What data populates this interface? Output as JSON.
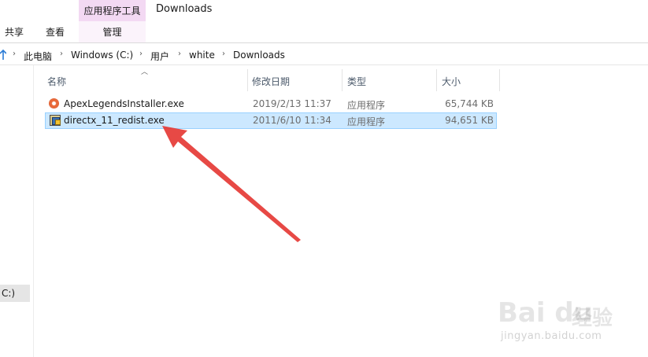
{
  "ribbon": {
    "tabs": [
      {
        "label": "共享"
      },
      {
        "label": "查看"
      }
    ],
    "contextual_group": "应用程序工具",
    "contextual_tab": "管理",
    "window_title": "Downloads"
  },
  "breadcrumb": [
    "此电脑",
    "Windows (C:)",
    "用户",
    "white",
    "Downloads"
  ],
  "columns": {
    "name": "名称",
    "date": "修改日期",
    "type": "类型",
    "size": "大小"
  },
  "files": [
    {
      "name": "ApexLegendsInstaller.exe",
      "date": "2019/2/13 11:37",
      "type": "应用程序",
      "size": "65,744 KB",
      "icon": "apex-icon",
      "selected": false
    },
    {
      "name": "directx_11_redist.exe",
      "date": "2011/6/10 11:34",
      "type": "应用程序",
      "size": "94,651 KB",
      "icon": "directx-installer-icon",
      "selected": true
    }
  ],
  "left_pane": {
    "selected_item_fragment": "C:)"
  },
  "watermark": {
    "logo": "Bai du",
    "cn": "经验",
    "url": "jingyan.baidu.com"
  },
  "colors": {
    "selection": "#cce8ff",
    "annotation_arrow": "#e53935",
    "context_tab": "#f3d9f3"
  }
}
